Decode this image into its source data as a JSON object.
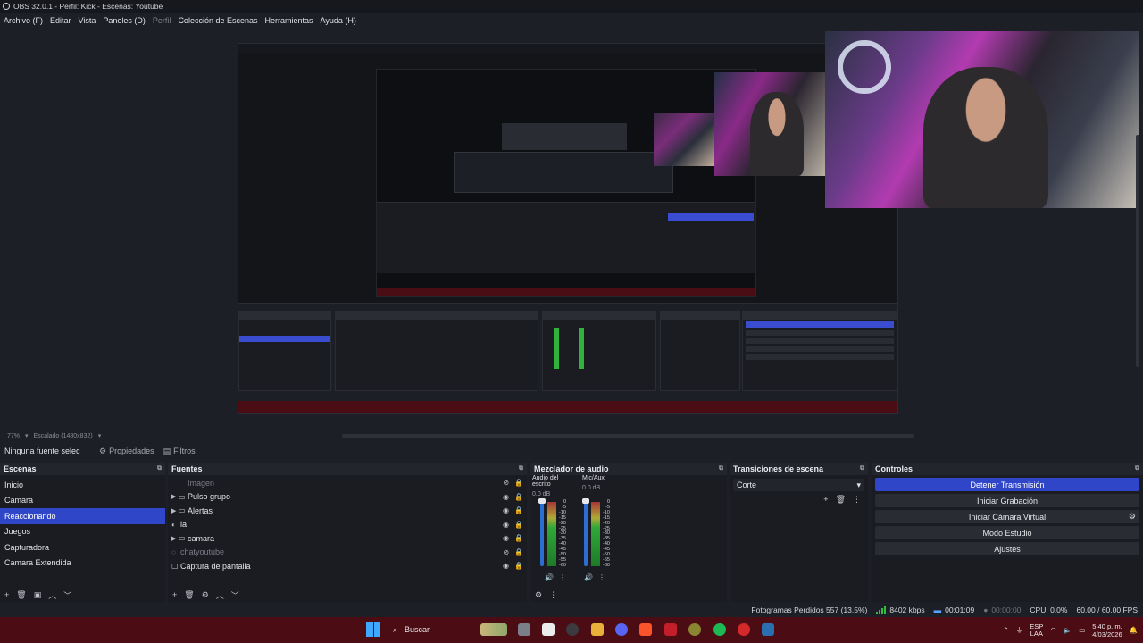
{
  "window": {
    "title": "OBS 32.0.1 - Perfil: Kick - Escenas: Youtube"
  },
  "menu": [
    {
      "label": "Archivo (F)",
      "disabled": false
    },
    {
      "label": "Editar",
      "disabled": false
    },
    {
      "label": "Vista",
      "disabled": false
    },
    {
      "label": "Paneles (D)",
      "disabled": false
    },
    {
      "label": "Perfil",
      "disabled": true
    },
    {
      "label": "Colección de Escenas",
      "disabled": false
    },
    {
      "label": "Herramientas",
      "disabled": false
    },
    {
      "label": "Ayuda (H)",
      "disabled": false
    }
  ],
  "preview": {
    "zoom": "77%",
    "scale_label": "Escalado (1480x832)"
  },
  "source_toolbar": {
    "no_source": "Ninguna fuente selec",
    "properties": "Propiedades",
    "filters": "Filtros"
  },
  "scenes": {
    "title": "Escenas",
    "items": [
      "Inicio",
      "Camara",
      "Reaccionando",
      "Juegos",
      "Capturadora",
      "Camara Extendida"
    ],
    "selected_index": 2
  },
  "sources": {
    "title": "Fuentes",
    "items": [
      {
        "label": "Imagen",
        "group": false,
        "dim": true
      },
      {
        "label": "Pulso grupo",
        "group": true,
        "dim": false
      },
      {
        "label": "Alertas",
        "group": true,
        "dim": false
      },
      {
        "label": "la",
        "group": false,
        "dim": false
      },
      {
        "label": "camara",
        "group": true,
        "dim": false
      },
      {
        "label": "chatyoutube",
        "group": false,
        "dim": true
      },
      {
        "label": "Captura de pantalla",
        "group": false,
        "dim": false
      }
    ]
  },
  "mixer": {
    "title": "Mezclador de audio",
    "channels": [
      {
        "name": "Audio del escrito",
        "db": "0.0 dB"
      },
      {
        "name": "Mic/Aux",
        "db": "0.0 dB"
      }
    ],
    "ticks": [
      "0",
      "-5",
      "-10",
      "-15",
      "-20",
      "-25",
      "-30",
      "-35",
      "-40",
      "-45",
      "-50",
      "-55",
      "-60"
    ]
  },
  "transitions": {
    "title": "Transiciones de escena",
    "selected": "Corte"
  },
  "controls": {
    "title": "Controles",
    "stop_stream": "Detener Transmisión",
    "start_recording": "Iniciar Grabación",
    "virtual_cam": "Iniciar Cámara Virtual",
    "studio_mode": "Modo Estudio",
    "settings": "Ajustes"
  },
  "status": {
    "dropped_frames": "Fotogramas Perdidos 557 (13.5%)",
    "bitrate": "8402 kbps",
    "stream_time": "00:01:09",
    "record_time": "00:00:00",
    "cpu": "CPU: 0.0%",
    "fps": "60.00 / 60.00 FPS"
  },
  "taskbar": {
    "search_label": "Buscar",
    "lang_1": "ESP",
    "lang_2": "LAA",
    "time": "5:40 p. m.",
    "date": "4/03/2026"
  },
  "colors": {
    "accent": "#2f46c9",
    "taskbar": "#4b0c13",
    "background": "#1d1f26"
  }
}
